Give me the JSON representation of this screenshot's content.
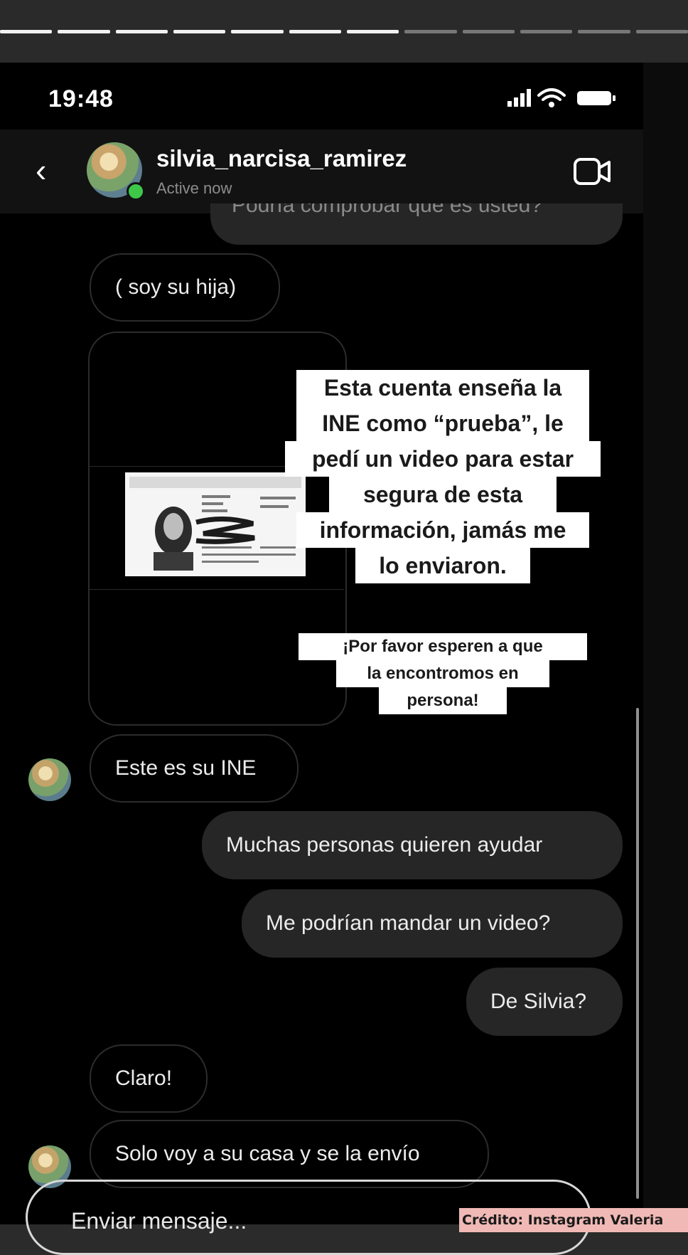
{
  "story": {
    "segments_total": 12,
    "segments_viewed": 7
  },
  "status_bar": {
    "time": "19:48"
  },
  "header": {
    "username": "silvia_narcisa_ramirez",
    "status": "Active now"
  },
  "messages": {
    "cut_off": "Podría comprobar que es usted?",
    "m1": "( soy su hija)",
    "m2": "Este es su INE",
    "m3": "Muchas personas quieren ayudar",
    "m4": "Me podrían mandar un video?",
    "m5": "De Silvia?",
    "m6": "Claro!",
    "m7": "Solo voy a su casa y se la envío"
  },
  "annotation_main": [
    "Esta cuenta enseña la",
    "INE como “prueba”, le",
    "pedí un video para estar",
    "segura de esta",
    "información, jamás me",
    "lo enviaron."
  ],
  "annotation_secondary": [
    "¡Por favor esperen a que",
    "la encontromos en",
    "persona!"
  ],
  "composer": {
    "placeholder": "Enviar mensaje..."
  },
  "credit": "Crédito: Instagram Valeria",
  "colors": {
    "online": "#3ec84a",
    "sent_bubble": "#262626",
    "credit_bg": "#f0b9b5"
  }
}
